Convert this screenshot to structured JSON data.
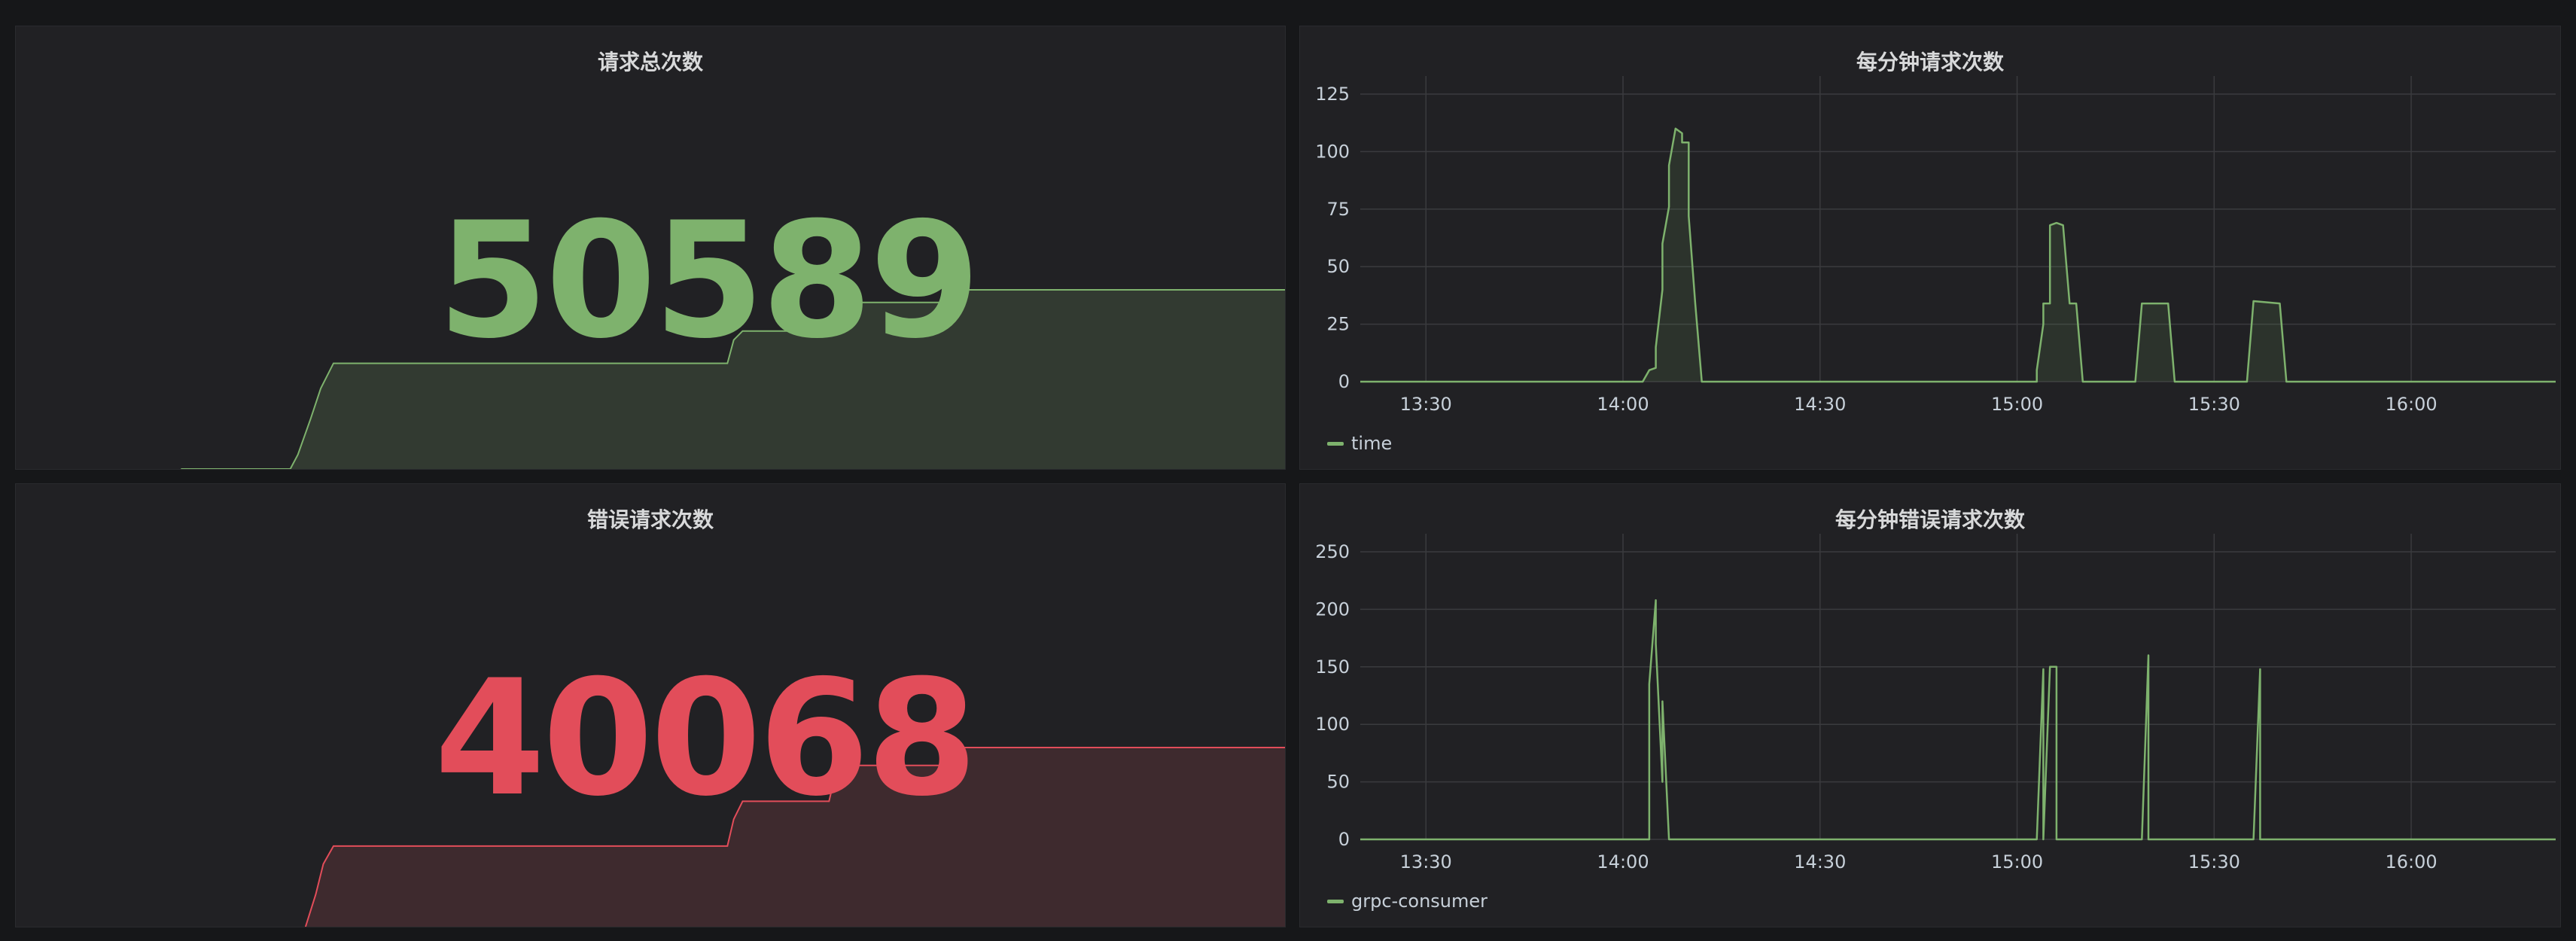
{
  "panels": {
    "total": {
      "title": "请求总次数",
      "value": "50589",
      "color": "#7eb26d",
      "fill": "#323a31",
      "sparkline": [
        [
          0.13,
          0
        ],
        [
          0.216,
          0
        ],
        [
          0.222,
          0.08
        ],
        [
          0.232,
          0.28
        ],
        [
          0.24,
          0.45
        ],
        [
          0.25,
          0.59
        ],
        [
          0.56,
          0.59
        ],
        [
          0.565,
          0.72
        ],
        [
          0.572,
          0.77
        ],
        [
          0.64,
          0.77
        ],
        [
          0.646,
          0.9
        ],
        [
          0.652,
          0.93
        ],
        [
          0.74,
          0.93
        ],
        [
          0.746,
          1
        ],
        [
          1,
          1
        ]
      ]
    },
    "errors": {
      "title": "错误请求次数",
      "value": "40068",
      "color": "#e24d5a",
      "fill": "#3e2a2e",
      "sparkline": [
        [
          0.228,
          0
        ],
        [
          0.236,
          0.18
        ],
        [
          0.242,
          0.35
        ],
        [
          0.25,
          0.45
        ],
        [
          0.56,
          0.45
        ],
        [
          0.565,
          0.6
        ],
        [
          0.572,
          0.7
        ],
        [
          0.64,
          0.7
        ],
        [
          0.646,
          0.88
        ],
        [
          0.652,
          0.9
        ],
        [
          0.74,
          0.9
        ],
        [
          0.746,
          1
        ],
        [
          1,
          1
        ]
      ]
    },
    "per_minute": {
      "title": "每分钟请求次数",
      "legend": "time",
      "color": "#7eb26d"
    },
    "errors_per_minute": {
      "title": "每分钟错误请求次数",
      "legend": "grpc-consumer",
      "color": "#7eb26d"
    }
  },
  "chart_data": [
    {
      "type": "area",
      "title": "每分钟请求次数",
      "xlabel": "",
      "ylabel": "",
      "x_ticks": [
        "13:30",
        "14:00",
        "14:30",
        "15:00",
        "15:30",
        "16:00"
      ],
      "y_ticks": [
        0,
        25,
        50,
        75,
        100,
        125
      ],
      "ylim": [
        0,
        125
      ],
      "xlim": [
        "13:20",
        "16:22"
      ],
      "legend": "bottom-left",
      "grid": true,
      "series": [
        {
          "name": "time",
          "x": [
            "13:20",
            "14:03",
            "14:04",
            "14:05",
            "14:05",
            "14:06",
            "14:06",
            "14:07",
            "14:07",
            "14:08",
            "14:09",
            "14:09",
            "14:10",
            "14:10",
            "14:11",
            "14:12",
            "15:03",
            "15:03",
            "15:04",
            "15:04",
            "15:05",
            "15:05",
            "15:06",
            "15:07",
            "15:08",
            "15:08",
            "15:09",
            "15:10",
            "15:18",
            "15:19",
            "15:23",
            "15:24",
            "15:35",
            "15:36",
            "15:40",
            "15:41",
            "16:22"
          ],
          "y": [
            0,
            0,
            5,
            6,
            15,
            40,
            60,
            76,
            94,
            110,
            108,
            104,
            104,
            72,
            34,
            0,
            0,
            5,
            25,
            34,
            34,
            68,
            69,
            68,
            34,
            34,
            34,
            0,
            0,
            34,
            34,
            0,
            0,
            35,
            34,
            0,
            0
          ]
        }
      ]
    },
    {
      "type": "line",
      "title": "每分钟错误请求次数",
      "xlabel": "",
      "ylabel": "",
      "x_ticks": [
        "13:30",
        "14:00",
        "14:30",
        "15:00",
        "15:30",
        "16:00"
      ],
      "y_ticks": [
        0,
        50,
        100,
        150,
        200,
        250
      ],
      "ylim": [
        0,
        250
      ],
      "xlim": [
        "13:20",
        "16:22"
      ],
      "legend": "bottom-left",
      "grid": true,
      "series": [
        {
          "name": "grpc-consumer",
          "x": [
            "13:20",
            "14:03",
            "14:04",
            "14:04",
            "14:05",
            "14:05",
            "14:06",
            "14:06",
            "14:06",
            "14:07",
            "14:07",
            "14:08",
            "15:03",
            "15:04",
            "15:04",
            "15:05",
            "15:06",
            "15:06",
            "15:19",
            "15:20",
            "15:20",
            "15:36",
            "15:37",
            "15:37",
            "16:22"
          ],
          "y": [
            0,
            0,
            0,
            135,
            208,
            170,
            50,
            120,
            120,
            0,
            0,
            0,
            0,
            148,
            0,
            150,
            150,
            0,
            0,
            160,
            0,
            0,
            148,
            0,
            0
          ]
        }
      ]
    }
  ]
}
